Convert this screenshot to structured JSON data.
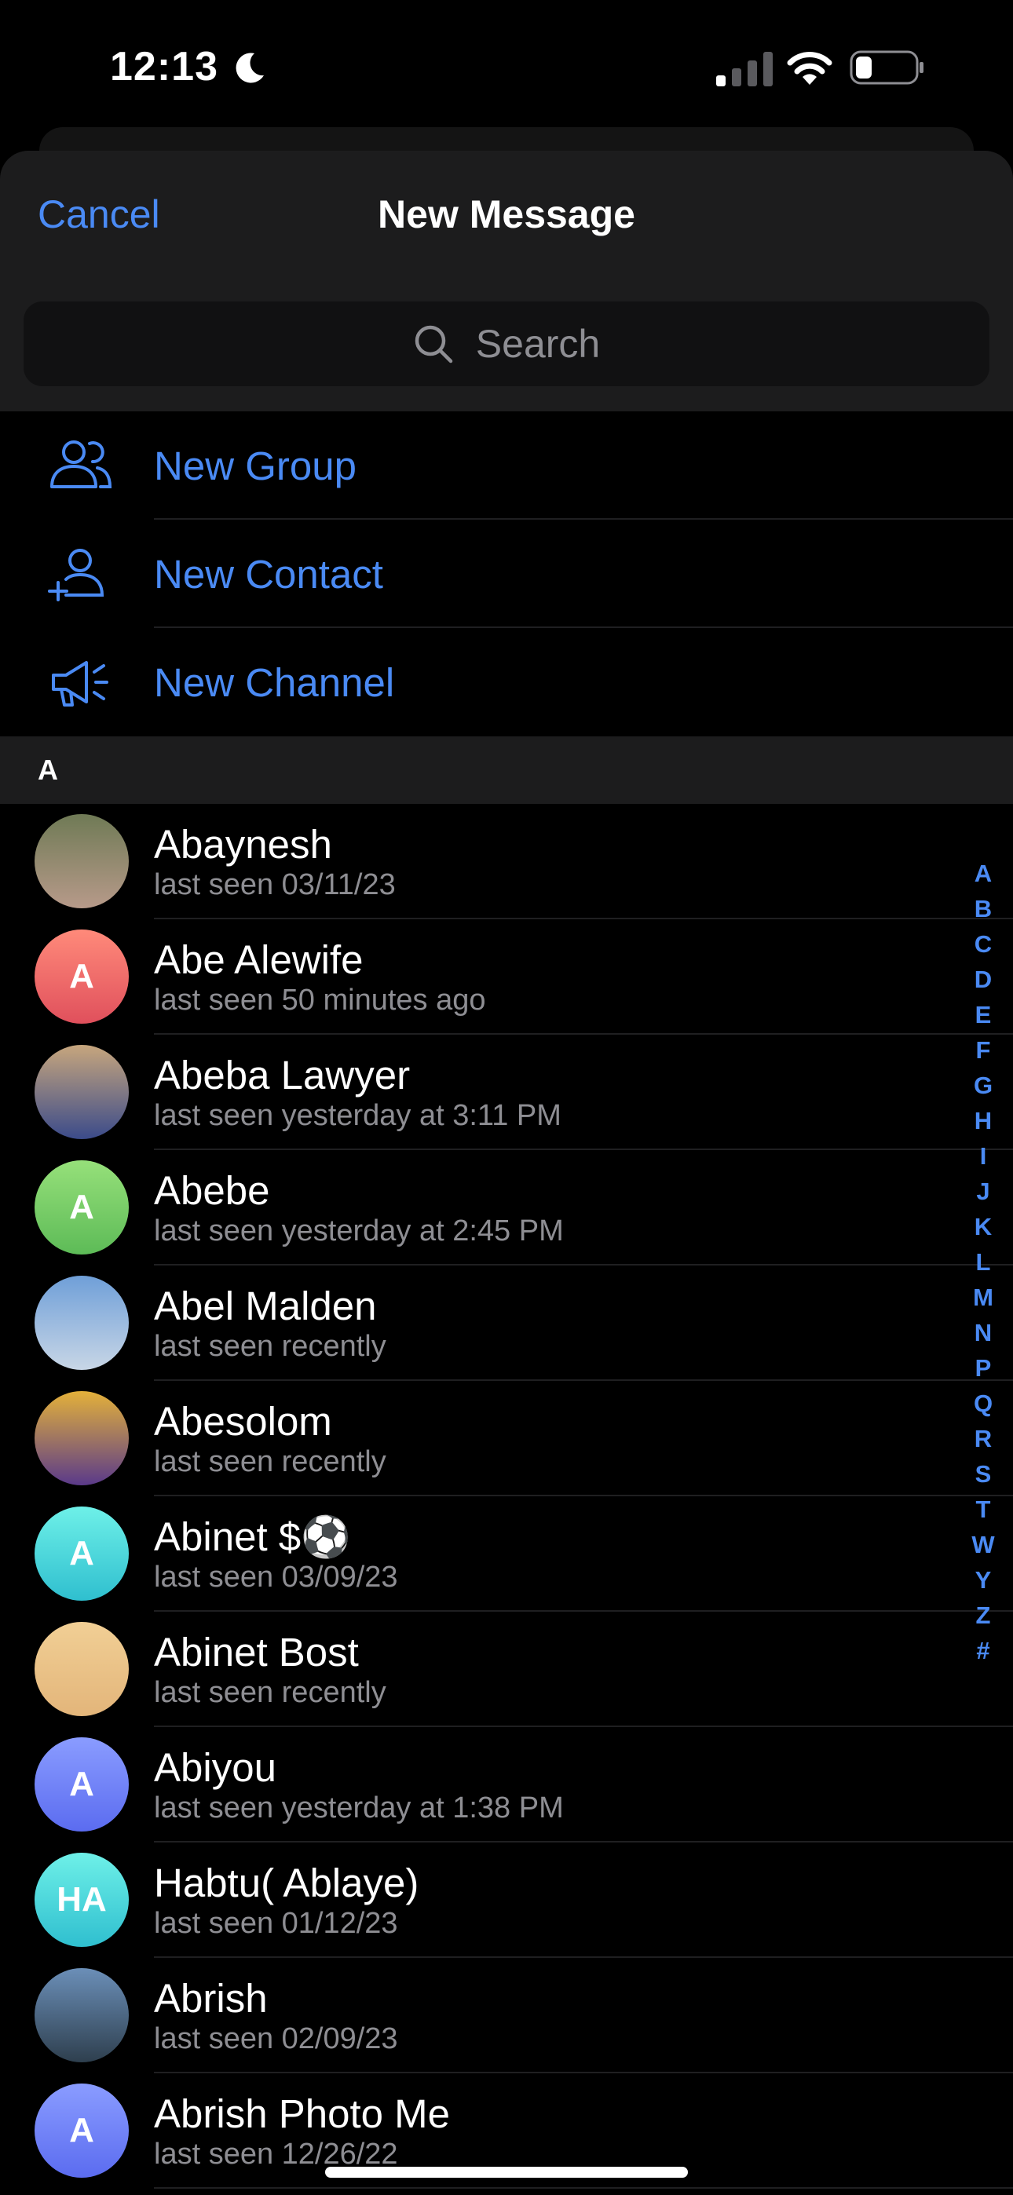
{
  "status_bar": {
    "time": "12:13",
    "icons": [
      "moon-icon",
      "signal-icon",
      "wifi-icon",
      "battery-icon"
    ]
  },
  "header": {
    "cancel_label": "Cancel",
    "title": "New Message",
    "search_placeholder": "Search"
  },
  "actions": [
    {
      "label": "New Group",
      "icon": "group-icon"
    },
    {
      "label": "New Contact",
      "icon": "add-contact-icon"
    },
    {
      "label": "New Channel",
      "icon": "megaphone-icon"
    }
  ],
  "section": {
    "letter": "A"
  },
  "contacts": [
    {
      "name": "Abaynesh",
      "status": "last seen 03/11/23",
      "avatar": "photo",
      "colors": [
        "#6f7a55",
        "#b79a8a"
      ]
    },
    {
      "name": "Abe Alewife",
      "status": "last seen 50 minutes ago",
      "avatar": "A",
      "colors": [
        "#ff8a7a",
        "#e0505c"
      ]
    },
    {
      "name": "Abeba Lawyer",
      "status": "last seen yesterday at 3:11 PM",
      "avatar": "photo",
      "colors": [
        "#c7a67d",
        "#3b4b8a"
      ]
    },
    {
      "name": "Abebe",
      "status": "last seen yesterday at 2:45 PM",
      "avatar": "A",
      "colors": [
        "#96e07a",
        "#5dbb57"
      ]
    },
    {
      "name": "Abel Malden",
      "status": "last seen recently",
      "avatar": "photo",
      "colors": [
        "#6f9fd8",
        "#c8d6e6"
      ]
    },
    {
      "name": "Abesolom",
      "status": "last seen recently",
      "avatar": "photo",
      "colors": [
        "#e4b13a",
        "#5a3a8a"
      ]
    },
    {
      "name": "Abinet $⚽",
      "status": "last seen 03/09/23",
      "avatar": "A",
      "colors": [
        "#6ef0e8",
        "#2fbfcf"
      ]
    },
    {
      "name": "Abinet Bost",
      "status": "last seen recently",
      "avatar": "photo",
      "colors": [
        "#f1cf95",
        "#e3b57a"
      ]
    },
    {
      "name": "Abiyou",
      "status": "last seen yesterday at 1:38 PM",
      "avatar": "A",
      "colors": [
        "#8a9cff",
        "#5b6cf0"
      ]
    },
    {
      "name": "Habtu( Ablaye)",
      "status": "last seen 01/12/23",
      "avatar": "HA",
      "colors": [
        "#6ef0e8",
        "#2fbfcf"
      ]
    },
    {
      "name": "Abrish",
      "status": "last seen 02/09/23",
      "avatar": "photo",
      "colors": [
        "#6b8fb8",
        "#2e3f4e"
      ]
    },
    {
      "name": "Abrish Photo Me",
      "status": "last seen 12/26/22",
      "avatar": "A",
      "colors": [
        "#8a9cff",
        "#5b6cf0"
      ]
    }
  ],
  "alpha_index": [
    "A",
    "B",
    "C",
    "D",
    "E",
    "F",
    "G",
    "H",
    "I",
    "J",
    "K",
    "L",
    "M",
    "N",
    "P",
    "Q",
    "R",
    "S",
    "T",
    "W",
    "Y",
    "Z",
    "#"
  ]
}
